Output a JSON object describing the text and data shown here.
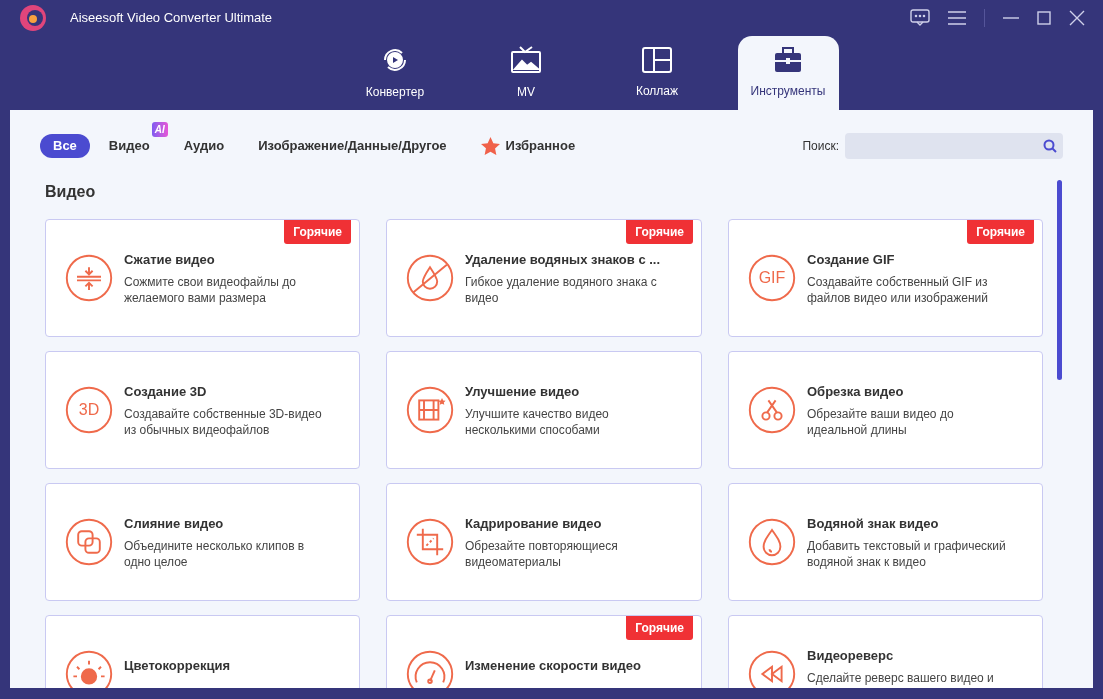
{
  "window": {
    "title": "Aiseesoft Video Converter Ultimate"
  },
  "tabs": [
    {
      "label": "Конвертер",
      "selected": false
    },
    {
      "label": "MV",
      "selected": false
    },
    {
      "label": "Коллаж",
      "selected": false
    },
    {
      "label": "Инструменты",
      "selected": true
    }
  ],
  "filters": [
    {
      "label": "Все",
      "selected": true
    },
    {
      "label": "Видео",
      "selected": false,
      "badge": "AI"
    },
    {
      "label": "Аудио",
      "selected": false
    },
    {
      "label": "Изображение/Данные/Другое",
      "selected": false
    },
    {
      "label": "Избранное",
      "selected": false,
      "star": true
    }
  ],
  "search": {
    "label": "Поиск:"
  },
  "section": "Видео",
  "tools": [
    {
      "title": "Сжатие видео",
      "description": "Сожмите свои видеофайлы до желаемого вами размера",
      "badge": "Горячие"
    },
    {
      "title": "Удаление водяных знаков с ...",
      "description": "Гибкое удаление водяного знака с видео",
      "badge": "Горячие"
    },
    {
      "title": "Создание GIF",
      "icon_label": "GIF",
      "description": "Создавайте собственный GIF из файлов видео или изображений",
      "badge": "Горячие"
    },
    {
      "title": "Создание 3D",
      "icon_label": "3D",
      "description": "Создавайте собственные 3D-видео из обычных видеофайлов"
    },
    {
      "title": "Улучшение видео",
      "description": "Улучшите качество видео несколькими способами"
    },
    {
      "title": "Обрезка видео",
      "description": "Обрезайте ваши видео до идеальной длины"
    },
    {
      "title": "Слияние видео",
      "description": "Объедините несколько клипов в одно целое"
    },
    {
      "title": "Кадрирование видео",
      "description": "Обрезайте повторяющиеся видеоматериалы"
    },
    {
      "title": "Водяной знак видео",
      "description": "Добавить текстовый и графический водяной знак к видео"
    },
    {
      "title": "Цветокоррекция"
    },
    {
      "title": "Изменение скорости видео",
      "badge": "Горячие"
    },
    {
      "title": "Видеореверс",
      "description": "Сделайте реверс вашего видео и"
    }
  ]
}
